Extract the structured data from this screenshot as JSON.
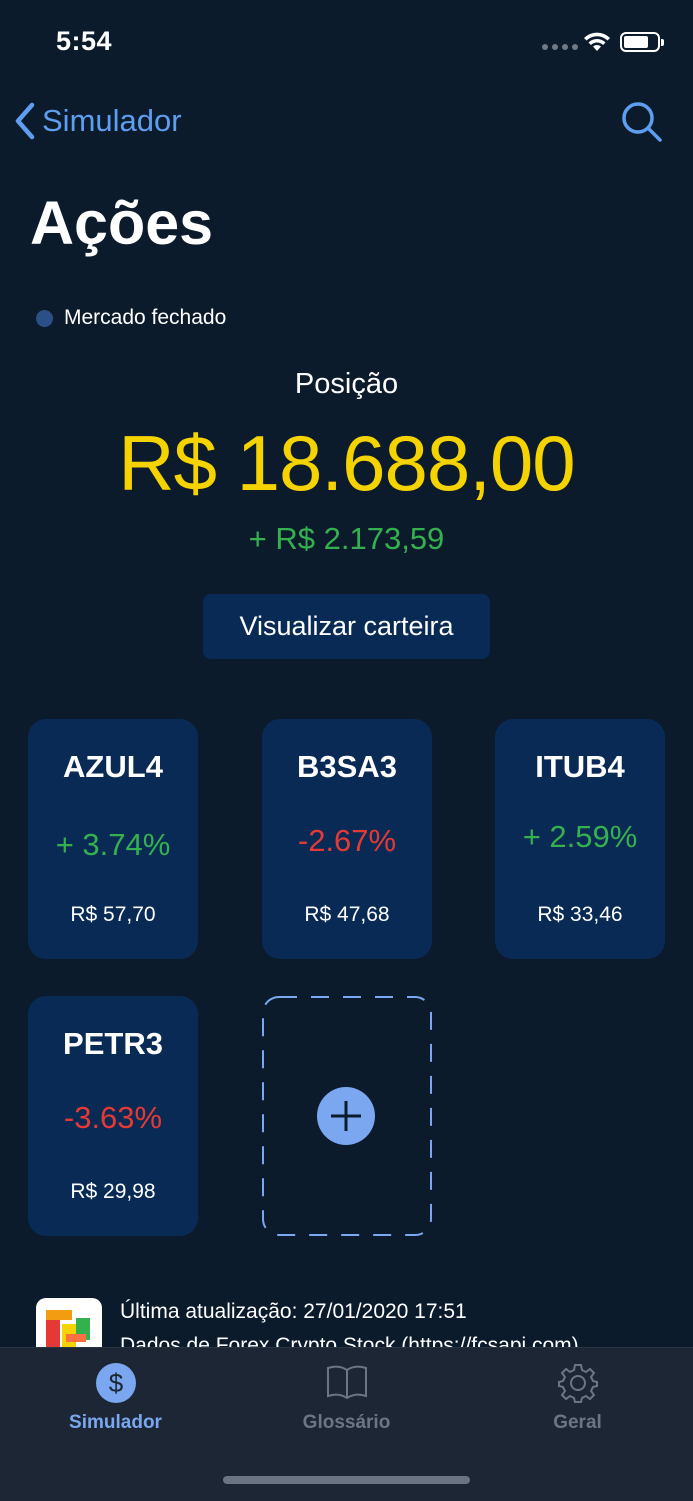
{
  "status_bar": {
    "time": "5:54"
  },
  "nav": {
    "back_label": "Simulador"
  },
  "title": "Ações",
  "market_status": "Mercado fechado",
  "position": {
    "label": "Posição",
    "value": "R$ 18.688,00",
    "change": "+ R$ 2.173,59"
  },
  "wallet_button": "Visualizar carteira",
  "stocks": [
    {
      "symbol": "AZUL4",
      "change": "+ 3.74%",
      "price": "R$ 57,70"
    },
    {
      "symbol": "B3SA3",
      "change": "-2.67%",
      "price": "R$ 47,68"
    },
    {
      "symbol": "ITUB4",
      "change": "+ 2.59%",
      "price": "R$ 33,46"
    },
    {
      "symbol": "PETR3",
      "change": "-3.63%",
      "price": "R$ 29,98"
    }
  ],
  "footer": {
    "last_update": "Última atualização: 27/01/2020 17:51",
    "source": "Dados de Forex Crypto Stock (https://fcsapi.com)"
  },
  "tabs": [
    {
      "label": "Simulador",
      "icon": "dollar-icon"
    },
    {
      "label": "Glossário",
      "icon": "book-icon"
    },
    {
      "label": "Geral",
      "icon": "gear-icon"
    }
  ],
  "colors": {
    "background": "#0c1b2c",
    "card": "#082a54",
    "accent": "#5e9ef0",
    "position_value": "#f5d300",
    "positive": "#35b04f",
    "negative": "#e53935"
  }
}
